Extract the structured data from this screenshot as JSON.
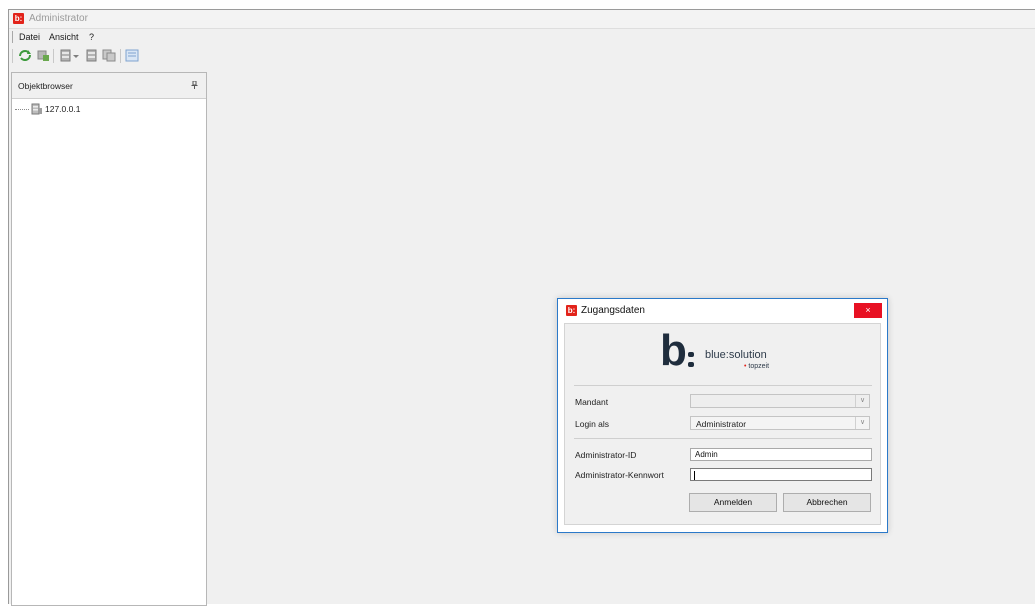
{
  "window": {
    "title": "Administrator",
    "logo_text": "b:"
  },
  "menu": {
    "items": [
      "Datei",
      "Ansicht",
      "?"
    ]
  },
  "panel": {
    "title": "Objektbrowser",
    "tree": [
      {
        "label": "127.0.0.1"
      }
    ]
  },
  "dialog": {
    "title": "Zugangsdaten",
    "close_label": "×",
    "brand": {
      "mark": "b",
      "name": "blue:solution",
      "sub_dot": "•",
      "sub": "topzeit"
    },
    "fields": {
      "mandant_label": "Mandant",
      "mandant_value": "",
      "login_label": "Login als",
      "login_value": "Administrator",
      "admin_id_label": "Administrator-ID",
      "admin_id_value": "Admin",
      "password_label": "Administrator-Kennwort",
      "password_value": ""
    },
    "buttons": {
      "login": "Anmelden",
      "cancel": "Abbrechen"
    }
  },
  "colors": {
    "accent_red": "#e2231a",
    "close_red": "#e81123",
    "dialog_border": "#2b79c9",
    "brand_dark": "#1f2d3d"
  },
  "icons": [
    "refresh-icon",
    "disconnect-icon",
    "add-server-icon",
    "dropdown-arrow-icon",
    "remove-server-icon",
    "copy-icon",
    "properties-icon",
    "pin-icon",
    "server-icon",
    "combo-arrow-icon"
  ]
}
